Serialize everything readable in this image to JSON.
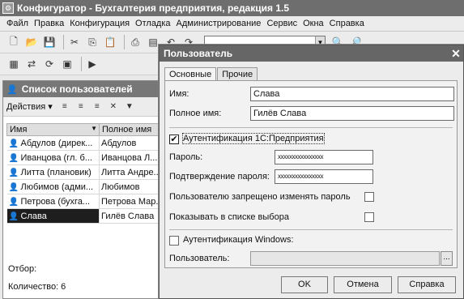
{
  "window": {
    "title": "Конфигуратор - Бухгалтерия предприятия, редакция 1.5"
  },
  "menu": [
    "Файл",
    "Правка",
    "Конфигурация",
    "Отладка",
    "Администрирование",
    "Сервис",
    "Окна",
    "Справка"
  ],
  "user_list": {
    "title": "Список пользователей",
    "actions_label": "Действия",
    "columns": [
      "Имя",
      "Полное имя"
    ],
    "rows": [
      {
        "name": "Абдулов (дирек...",
        "full": "Абдулов"
      },
      {
        "name": "Иванцова (гл. б...",
        "full": "Иванцова Л..."
      },
      {
        "name": "Литта (плановик)",
        "full": "Литта Андре..."
      },
      {
        "name": "Любимов (адми...",
        "full": "Любимов"
      },
      {
        "name": "Петрова (бухга...",
        "full": "Петрова Мар..."
      },
      {
        "name": "Слава",
        "full": "Гилёв Слава"
      }
    ],
    "filter_label": "Отбор:",
    "count_label": "Количество: 6"
  },
  "dialog": {
    "title": "Пользователь",
    "tabs": [
      "Основные",
      "Прочие"
    ],
    "name_label": "Имя:",
    "name_value": "Слава",
    "fullname_label": "Полное имя:",
    "fullname_value": "Гилёв Слава",
    "auth_1c_label": "Аутентификация 1С:Предприятия",
    "auth_1c_checked": true,
    "password_label": "Пароль:",
    "password_value": "xxxxxxxxxxxxxxxx",
    "confirm_label": "Подтверждение пароля:",
    "confirm_value": "xxxxxxxxxxxxxxxx",
    "forbid_change_label": "Пользователю запрещено изменять пароль",
    "show_in_list_label": "Показывать в списке выбора",
    "auth_windows_label": "Аутентификация Windows:",
    "windows_user_label": "Пользователь:",
    "windows_user_value": "",
    "ellipsis": "...",
    "ok": "OK",
    "cancel": "Отмена",
    "help": "Справка"
  }
}
